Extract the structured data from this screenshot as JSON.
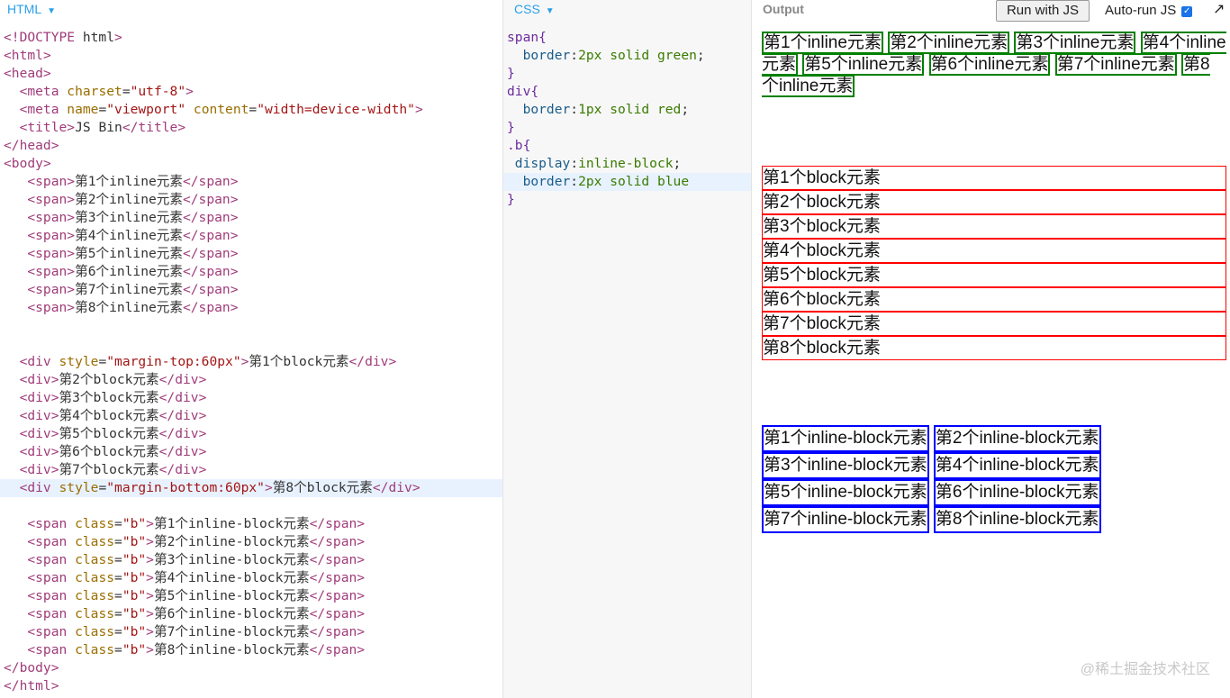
{
  "panels": {
    "html_title": "HTML",
    "css_title": "CSS",
    "output_title": "Output",
    "caret": "▼"
  },
  "toolbar": {
    "run_label": "Run with JS",
    "autorun_label": "Auto-run JS",
    "autorun_checked": "✓",
    "popout": "↗"
  },
  "html_code": [
    "<!DOCTYPE html>",
    "<html>",
    "<head>",
    "  <meta charset=\"utf-8\">",
    "  <meta name=\"viewport\" content=\"width=device-width\">",
    "  <title>JS Bin</title>",
    "</head>",
    "<body>",
    "   <span>第1个inline元素</span>",
    "   <span>第2个inline元素</span>",
    "   <span>第3个inline元素</span>",
    "   <span>第4个inline元素</span>",
    "   <span>第5个inline元素</span>",
    "   <span>第6个inline元素</span>",
    "   <span>第7个inline元素</span>",
    "   <span>第8个inline元素</span>",
    "",
    "",
    "  <div style=\"margin-top:60px\">第1个block元素</div>",
    "  <div>第2个block元素</div>",
    "  <div>第3个block元素</div>",
    "  <div>第4个block元素</div>",
    "  <div>第5个block元素</div>",
    "  <div>第6个block元素</div>",
    "  <div>第7个block元素</div>",
    "  <div style=\"margin-bottom:60px\">第8个block元素</div>",
    "",
    "   <span class=\"b\">第1个inline-block元素</span>",
    "   <span class=\"b\">第2个inline-block元素</span>",
    "   <span class=\"b\">第3个inline-block元素</span>",
    "   <span class=\"b\">第4个inline-block元素</span>",
    "   <span class=\"b\">第5个inline-block元素</span>",
    "   <span class=\"b\">第6个inline-block元素</span>",
    "   <span class=\"b\">第7个inline-block元素</span>",
    "   <span class=\"b\">第8个inline-block元素</span>",
    "</body>",
    "</html>"
  ],
  "css_code": [
    "span{",
    "  border:2px solid green;",
    "}",
    "div{",
    "  border:1px solid red;",
    "}",
    ".b{",
    " display:inline-block;",
    "  border:2px solid blue",
    "}"
  ],
  "output": {
    "inline": [
      "第1个inline元素",
      "第2个inline元素",
      "第3个inline元素",
      "第4个inline元素",
      "第5个inline元素",
      "第6个inline元素",
      "第7个inline元素",
      "第8个inline元素"
    ],
    "block": [
      "第1个block元素",
      "第2个block元素",
      "第3个block元素",
      "第4个block元素",
      "第5个block元素",
      "第6个block元素",
      "第7个block元素",
      "第8个block元素"
    ],
    "inline_block": [
      "第1个inline-block元素",
      "第2个inline-block元素",
      "第3个inline-block元素",
      "第4个inline-block元素",
      "第5个inline-block元素",
      "第6个inline-block元素",
      "第7个inline-block元素",
      "第8个inline-block元素"
    ]
  },
  "watermark": "@稀土掘金技术社区",
  "colors": {
    "accent": "#2aa0e8",
    "inline_border": "green",
    "block_border": "red",
    "inline_block_border": "blue"
  }
}
